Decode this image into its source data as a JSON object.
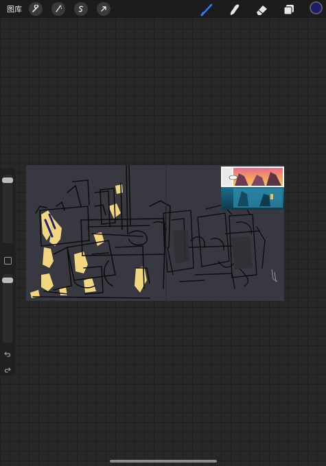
{
  "topbar": {
    "gallery_label": "图库",
    "left_tools": [
      {
        "icon": "wrench-icon"
      },
      {
        "icon": "magic-wand-icon"
      },
      {
        "icon": "selection-icon"
      },
      {
        "icon": "transform-arrow-icon"
      }
    ],
    "right_tools": [
      {
        "icon": "brush-icon",
        "active": true
      },
      {
        "icon": "smudge-icon"
      },
      {
        "icon": "eraser-icon"
      },
      {
        "icon": "layers-icon"
      }
    ],
    "current_color": "#1a1d6b",
    "active_tool_color": "#2f7bff"
  },
  "sidebar": {
    "brush_size_level": 0.05,
    "opacity_level": 0.05
  },
  "canvas": {
    "background_color": "#383840",
    "highlight_color": "#f2d77e"
  }
}
